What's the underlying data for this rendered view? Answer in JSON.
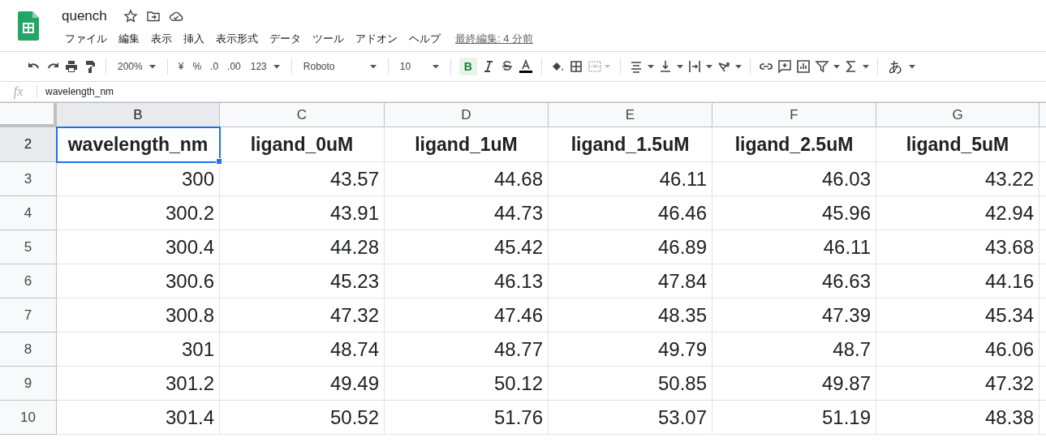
{
  "document": {
    "title": "quench",
    "last_edit": "最終編集: 4 分前"
  },
  "menu": [
    "ファイル",
    "編集",
    "表示",
    "挿入",
    "表示形式",
    "データ",
    "ツール",
    "アドオン",
    "ヘルプ"
  ],
  "toolbar": {
    "zoom": "200%",
    "currency": "¥",
    "percent": "%",
    "decrease_decimals": ".0",
    "increase_decimals": ".00",
    "more_formats": "123",
    "font": "Roboto",
    "font_size": "10",
    "bold": {
      "label": "B",
      "on": true
    },
    "merge_disabled": true,
    "input_tools": "あ"
  },
  "formula_bar": {
    "label": "fx",
    "value": "wavelength_nm"
  },
  "columns": [
    {
      "label": "B",
      "selected": true
    },
    {
      "label": "C",
      "selected": false
    },
    {
      "label": "D",
      "selected": false
    },
    {
      "label": "E",
      "selected": false
    },
    {
      "label": "F",
      "selected": false
    },
    {
      "label": "G",
      "selected": false
    }
  ],
  "rows": [
    {
      "number": "2",
      "kind": "header",
      "selected": true,
      "cells": [
        "wavelength_nm",
        "ligand_0uM",
        "ligand_1uM",
        "ligand_1.5uM",
        "ligand_2.5uM",
        "ligand_5uM"
      ]
    },
    {
      "number": "3",
      "kind": "data",
      "selected": false,
      "cells": [
        "300",
        "43.57",
        "44.68",
        "46.11",
        "46.03",
        "43.22"
      ]
    },
    {
      "number": "4",
      "kind": "data",
      "selected": false,
      "cells": [
        "300.2",
        "43.91",
        "44.73",
        "46.46",
        "45.96",
        "42.94"
      ]
    },
    {
      "number": "5",
      "kind": "data",
      "selected": false,
      "cells": [
        "300.4",
        "44.28",
        "45.42",
        "46.89",
        "46.11",
        "43.68"
      ]
    },
    {
      "number": "6",
      "kind": "data",
      "selected": false,
      "cells": [
        "300.6",
        "45.23",
        "46.13",
        "47.84",
        "46.63",
        "44.16"
      ]
    },
    {
      "number": "7",
      "kind": "data",
      "selected": false,
      "cells": [
        "300.8",
        "47.32",
        "47.46",
        "48.35",
        "47.39",
        "45.34"
      ]
    },
    {
      "number": "8",
      "kind": "data",
      "selected": false,
      "cells": [
        "301",
        "48.74",
        "48.77",
        "49.79",
        "48.7",
        "46.06"
      ]
    },
    {
      "number": "9",
      "kind": "data",
      "selected": false,
      "cells": [
        "301.2",
        "49.49",
        "50.12",
        "50.85",
        "49.87",
        "47.32"
      ]
    },
    {
      "number": "10",
      "kind": "data",
      "selected": false,
      "cells": [
        "301.4",
        "50.52",
        "51.76",
        "53.07",
        "51.19",
        "48.38"
      ]
    }
  ]
}
